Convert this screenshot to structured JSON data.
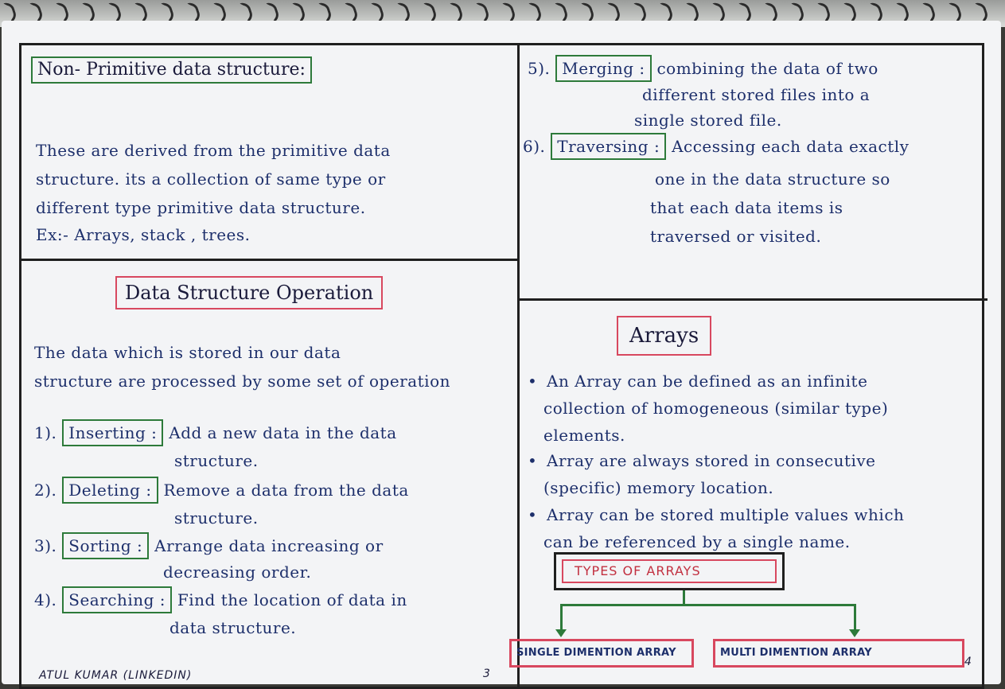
{
  "left_top": {
    "title": "Non- Primitive data structure:",
    "lines": [
      "These are derived from the primitive data",
      "structure. its a collection of same type or",
      "different type primitive data structure.",
      "Ex:- Arrays, stack , trees."
    ]
  },
  "left_bottom": {
    "title": "Data Structure Operation",
    "intro": [
      "The data which is stored in our data",
      "structure are processed by some set of operation"
    ],
    "ops": [
      {
        "num": "1).",
        "name": "Inserting :",
        "l1": "Add a new data in the data",
        "l2": "structure."
      },
      {
        "num": "2).",
        "name": "Deleting :",
        "l1": "Remove a data from the data",
        "l2": "structure."
      },
      {
        "num": "3).",
        "name": "Sorting :",
        "l1": "Arrange data increasing or",
        "l2": "decreasing order."
      },
      {
        "num": "4).",
        "name": "Searching :",
        "l1": "Find the location of data in",
        "l2": "data structure."
      }
    ],
    "footer": "ATUL KUMAR (LINKEDIN)",
    "page_num": "3"
  },
  "right_top": {
    "ops": [
      {
        "num": "5).",
        "name": "Merging :",
        "l1": "combining the data of two",
        "l2": "different stored files into a",
        "l3": "single stored file."
      },
      {
        "num": "6).",
        "name": "Traversing :",
        "l1": "Accessing each data exactly",
        "l2": "one in the data structure so",
        "l3": "that each data items is",
        "l4": "traversed or visited."
      }
    ]
  },
  "right_bottom": {
    "title": "Arrays",
    "bullets": [
      [
        "An Array can be defined as an infinite",
        "collection of homogeneous (similar type)",
        "elements."
      ],
      [
        "Array are always stored in consecutive",
        "(specific) memory location."
      ],
      [
        "Array can be stored multiple values which",
        "can be referenced by a single name."
      ]
    ],
    "types_title": "TYPES OF ARRAYS",
    "types": [
      "SINGLE DIMENTION ARRAY",
      "MULTI DIMENTION ARRAY"
    ],
    "page_num": "4"
  },
  "colors": {
    "ink": "#1d2f6b",
    "green_box": "#2d7a3a",
    "red_box": "#d8485f",
    "paper": "#f3f4f6"
  }
}
